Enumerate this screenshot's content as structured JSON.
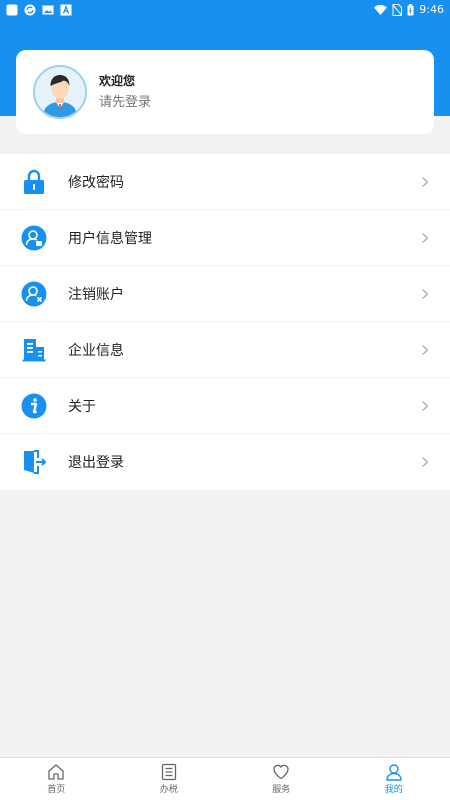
{
  "status_bar": {
    "time": "9:46",
    "left_icons": [
      "app-icon",
      "sync-icon",
      "image-icon",
      "font-icon"
    ],
    "right_icons": [
      "wifi-icon",
      "no-sim-icon",
      "battery-icon"
    ]
  },
  "colors": {
    "primary": "#1890f0",
    "background": "#f2f2f2",
    "avatar_border": "#9fd0ee"
  },
  "profile": {
    "welcome": "欢迎您",
    "login_prompt": "请先登录"
  },
  "menu": {
    "items": [
      {
        "label": "修改密码",
        "icon": "lock-icon"
      },
      {
        "label": "用户信息管理",
        "icon": "user-manage-icon"
      },
      {
        "label": "注销账户",
        "icon": "user-remove-icon"
      },
      {
        "label": "企业信息",
        "icon": "building-icon"
      },
      {
        "label": "关于",
        "icon": "info-icon"
      },
      {
        "label": "退出登录",
        "icon": "logout-icon"
      }
    ]
  },
  "tabs": {
    "items": [
      {
        "label": "首页",
        "icon": "home-icon",
        "active": false
      },
      {
        "label": "办税",
        "icon": "list-icon",
        "active": false
      },
      {
        "label": "服务",
        "icon": "heart-icon",
        "active": false
      },
      {
        "label": "我的",
        "icon": "user-icon",
        "active": true
      }
    ]
  }
}
